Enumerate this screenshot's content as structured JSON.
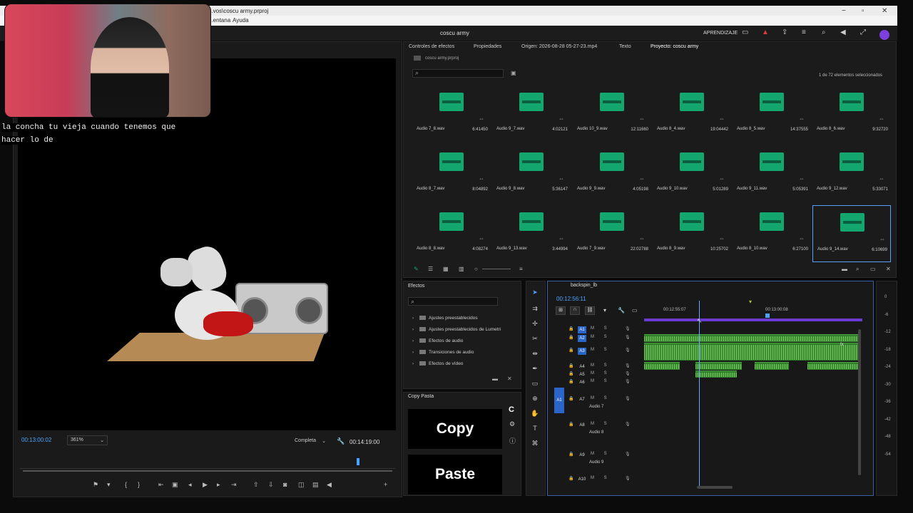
{
  "window": {
    "title_path": "...vos\\coscu army.prproj",
    "minimize": "−",
    "maximize": "▫",
    "close": "✕"
  },
  "menu": {
    "items": [
      "...entana",
      "Ayuda"
    ]
  },
  "app": {
    "project_name": "coscu army",
    "learn_label": "APRENDIZAJE"
  },
  "overlay": {
    "caption_line1": "la concha tu vieja cuando tenemos que",
    "caption_line2": "hacer lo de"
  },
  "program_monitor": {
    "timecode": "00:13:00:02",
    "zoom": "361%",
    "quality": "Completa",
    "duration": "00:14:19:00"
  },
  "project_panel": {
    "tabs": [
      "Controles de efectos",
      "Propiedades",
      "Origen: 2026-08-28 05-27-23.mp4",
      "Texto",
      "Proyecto: coscu army"
    ],
    "file": "coscu army.prproj",
    "selection_count": "1 de 72 elementos seleccionados",
    "items": [
      {
        "name": "Audio 7_8.wav",
        "duration": "6:41450"
      },
      {
        "name": "Audio 9_7.wav",
        "duration": "4:02121"
      },
      {
        "name": "Audio 10_9.wav",
        "duration": "12:11660"
      },
      {
        "name": "Audio 8_4.wav",
        "duration": "19:04442"
      },
      {
        "name": "Audio 8_5.wav",
        "duration": "14:37555"
      },
      {
        "name": "Audio 8_6.wav",
        "duration": "9:32720"
      },
      {
        "name": "Audio 8_7.wav",
        "duration": "8:04892"
      },
      {
        "name": "Audio 9_8.wav",
        "duration": "5:36147"
      },
      {
        "name": "Audio 9_9.wav",
        "duration": "4:05198"
      },
      {
        "name": "Audio 9_10.wav",
        "duration": "5:01289"
      },
      {
        "name": "Audio 9_11.wav",
        "duration": "5:05391"
      },
      {
        "name": "Audio 9_12.wav",
        "duration": "5:33071"
      },
      {
        "name": "Audio 8_8.wav",
        "duration": "4:08274"
      },
      {
        "name": "Audio 9_13.wav",
        "duration": "3:44994"
      },
      {
        "name": "Audio 7_9.wav",
        "duration": "22:02788"
      },
      {
        "name": "Audio 8_9.wav",
        "duration": "10:25702"
      },
      {
        "name": "Audio 8_10.wav",
        "duration": "6:27100"
      },
      {
        "name": "Audio 9_14.wav",
        "duration": "6:10699"
      }
    ]
  },
  "effects_panel": {
    "title": "Efectos",
    "items": [
      "Ajustes preestablecidos",
      "Ajustes preestablecidos de Lumetri",
      "Efectos de audio",
      "Transiciones de audio",
      "Efectos de vídeo"
    ]
  },
  "copypasta": {
    "title": "Copy Pasta",
    "copy": "Copy",
    "paste": "Paste"
  },
  "timeline": {
    "sequence": "backspin_lb",
    "timecode": "00:12:56:11",
    "tick1": "00:12:55:07",
    "tick2": "00:13:00:08",
    "tracks": [
      {
        "id": "A1",
        "name": ""
      },
      {
        "id": "A2",
        "name": ""
      },
      {
        "id": "A3",
        "name": ""
      },
      {
        "id": "A4",
        "name": ""
      },
      {
        "id": "A5",
        "name": ""
      },
      {
        "id": "A6",
        "name": ""
      },
      {
        "id": "A7",
        "name": "Audio 7"
      },
      {
        "id": "A8",
        "name": "Audio 8"
      },
      {
        "id": "A9",
        "name": "Audio 9"
      },
      {
        "id": "A10",
        "name": ""
      }
    ],
    "source_patch": "A1",
    "track_buttons": "M S"
  },
  "meters": {
    "labels": [
      "0",
      "-6",
      "-12",
      "-18",
      "-24",
      "-30",
      "-36",
      "-42",
      "-48",
      "-54"
    ]
  },
  "colors": {
    "accent": "#4aa3ff",
    "clip": "#2f7f2a",
    "work_area": "#6a3ad0",
    "warn": "#e03a3a"
  }
}
